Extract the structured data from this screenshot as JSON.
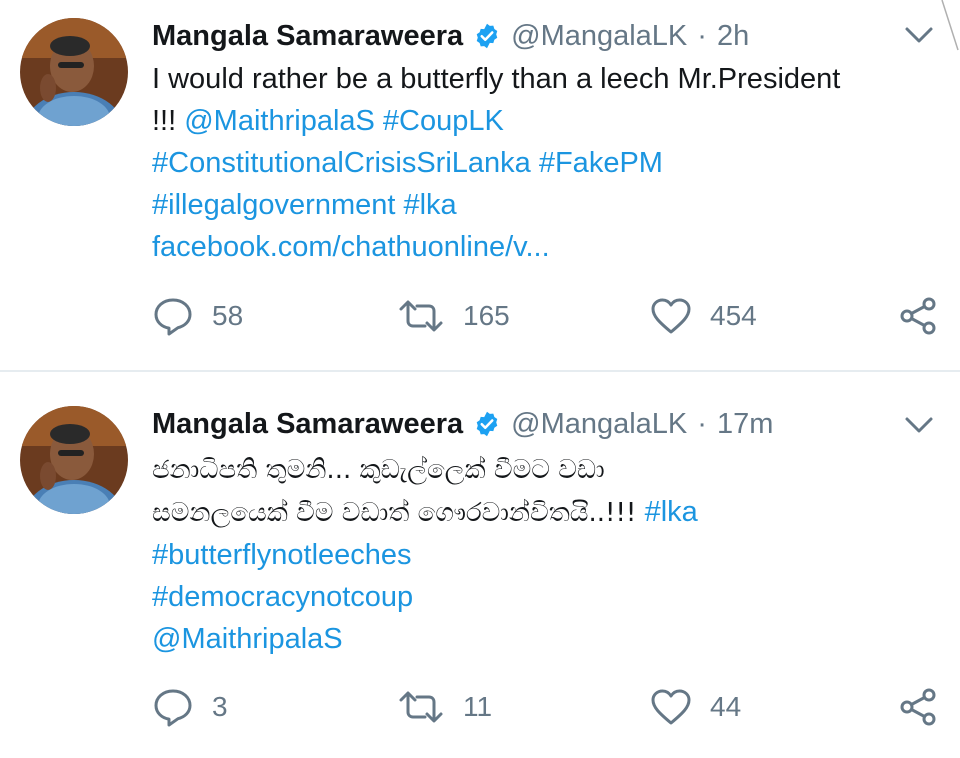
{
  "tweets": [
    {
      "author_name": "Mangala Samaraweera",
      "handle": "@MangalaLK",
      "separator": "·",
      "time": "2h",
      "text_lines": [
        [
          {
            "t": "I would rather be a butterfly than a leech Mr.President",
            "link": false
          }
        ],
        [
          {
            "t": "!!! ",
            "link": false
          },
          {
            "t": "@MaithripalaS #CoupLK",
            "link": true
          }
        ],
        [
          {
            "t": "#ConstitutionalCrisisSriLanka #FakePM",
            "link": true
          }
        ],
        [
          {
            "t": "#illegalgovernment #lka",
            "link": true
          }
        ],
        [
          {
            "t": "facebook.com/chathuonline/v...",
            "link": true
          }
        ]
      ],
      "replies": "58",
      "retweets": "165",
      "likes": "454"
    },
    {
      "author_name": "Mangala Samaraweera",
      "handle": "@MangalaLK",
      "separator": "·",
      "time": "17m",
      "text_lines": [
        [
          {
            "t": "ජනාධිපති තුමනි...  කුඩැල්ලෙක් වීමට වඩා",
            "link": false,
            "sinhala": true
          }
        ],
        [
          {
            "t": "සමනලයෙක් වීම වඩාත් ගෞරවාන්විතයි..!!! ",
            "link": false,
            "sinhala": true
          },
          {
            "t": "#lka",
            "link": true
          }
        ],
        [
          {
            "t": "#butterflynotleeches",
            "link": true
          }
        ],
        [
          {
            "t": "#democracynotcoup",
            "link": true
          }
        ],
        [
          {
            "t": "@MaithripalaS",
            "link": true
          }
        ]
      ],
      "replies": "3",
      "retweets": "11",
      "likes": "44"
    }
  ],
  "icons": {
    "verified": "verified-badge-icon",
    "more": "chevron-down-icon",
    "reply": "reply-icon",
    "retweet": "retweet-icon",
    "like": "heart-icon",
    "share": "share-icon"
  },
  "colors": {
    "link": "#1b95e0",
    "muted": "#657786",
    "text": "#14171a",
    "verified": "#1da1f2",
    "divider": "#e6ecf0"
  }
}
